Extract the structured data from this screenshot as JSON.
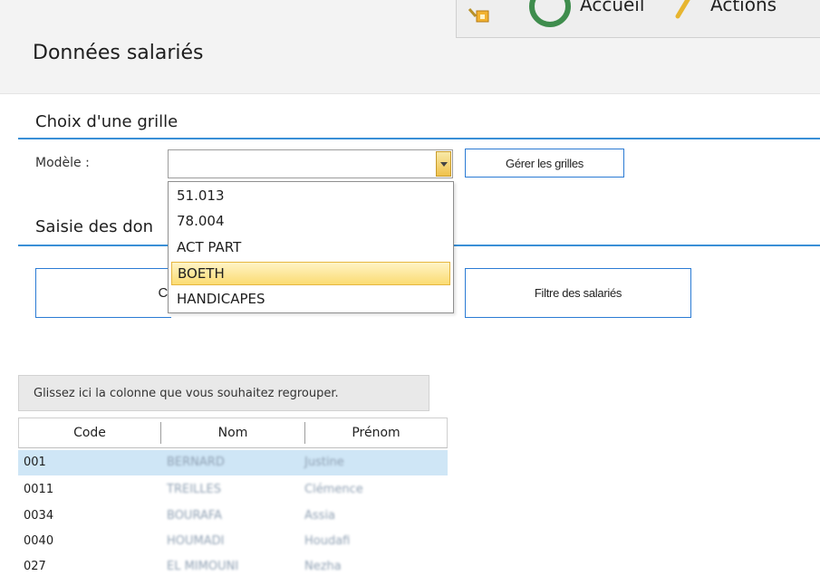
{
  "ribbon": {
    "home_label": "Accueil",
    "actions_label": "Actions"
  },
  "page": {
    "title": "Données salariés"
  },
  "grid_choice": {
    "section_title": "Choix d'une grille",
    "model_label": "Modèle :",
    "model_value": "",
    "manage_button": "Gérer les grilles",
    "options": [
      "51.013",
      "78.004",
      "ACT PART",
      "BOETH",
      "HANDICAPES"
    ],
    "highlighted_option": "BOETH"
  },
  "data_entry": {
    "section_title_visible": "Saisie des don",
    "left_button_visible": "C",
    "filter_button": "Filtre des salariés"
  },
  "grid": {
    "group_panel_text": "Glissez ici la colonne que vous souhaitez regrouper.",
    "columns": [
      "Code",
      "Nom",
      "Prénom"
    ],
    "rows": [
      {
        "code": "001",
        "nom": "BERNARD",
        "prenom": "Justine"
      },
      {
        "code": "0011",
        "nom": "TREILLES",
        "prenom": "Clémence"
      },
      {
        "code": "0034",
        "nom": "BOURAFA",
        "prenom": "Assia"
      },
      {
        "code": "0040",
        "nom": "HOUMADI",
        "prenom": "Houdafi"
      },
      {
        "code": "027",
        "nom": "EL MIMOUNI",
        "prenom": "Nezha"
      }
    ]
  },
  "colors": {
    "accent_line": "#3a8fd6",
    "selected_row": "#cfe6f6",
    "highlight_option": "#fbdc72"
  }
}
